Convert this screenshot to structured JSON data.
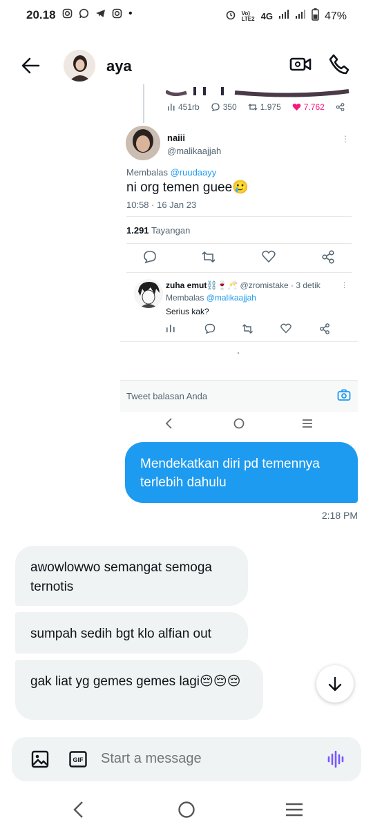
{
  "status_bar": {
    "time": "20.18",
    "network": "4G",
    "volte": "Vo) LTE2",
    "battery": "47%",
    "notification_dot": "•"
  },
  "header": {
    "contact_name": "aya",
    "icons": [
      "back-arrow-icon",
      "video-call-icon",
      "phone-icon"
    ]
  },
  "shared_tweet": {
    "parent_stats": {
      "views": "451rb",
      "replies": "350",
      "retweets": "1.975",
      "likes": "7.762"
    },
    "reply": {
      "name": "naiii",
      "handle": "@malikaajjah",
      "replying_prefix": "Membalas",
      "replying_to": "@ruudaayy",
      "text": "ni org temen guee🥲",
      "meta": "10:58 · 16 Jan 23",
      "views_count": "1.291",
      "views_label": "Tayangan"
    },
    "sub_reply": {
      "name": "zuha emut⛓️🍷🥂",
      "handle_time": "@zromistake · 3 detik",
      "replying_prefix": "Membalas",
      "replying_to": "@malikaajjah",
      "text": "Serius kak?"
    },
    "reply_placeholder": "Tweet balasan Anda",
    "more_glyph": "⋮"
  },
  "messages": {
    "sent": [
      {
        "text": "Mendekatkan diri pd temennya terlebih dahulu",
        "time": "2:18 PM"
      }
    ],
    "received": [
      {
        "text": "awowlowwo semangat semoga ternotis"
      },
      {
        "text": "sumpah sedih bgt klo alfian out"
      },
      {
        "text": "gak liat yg gemes gemes lagi😔😔😔"
      }
    ]
  },
  "composer": {
    "placeholder": "Start a message",
    "gif_label": "GIF"
  },
  "colors": {
    "accent": "#1d9bf0",
    "like": "#f91880",
    "voice": "#7856ff",
    "received_bubble": "#eff3f4"
  }
}
